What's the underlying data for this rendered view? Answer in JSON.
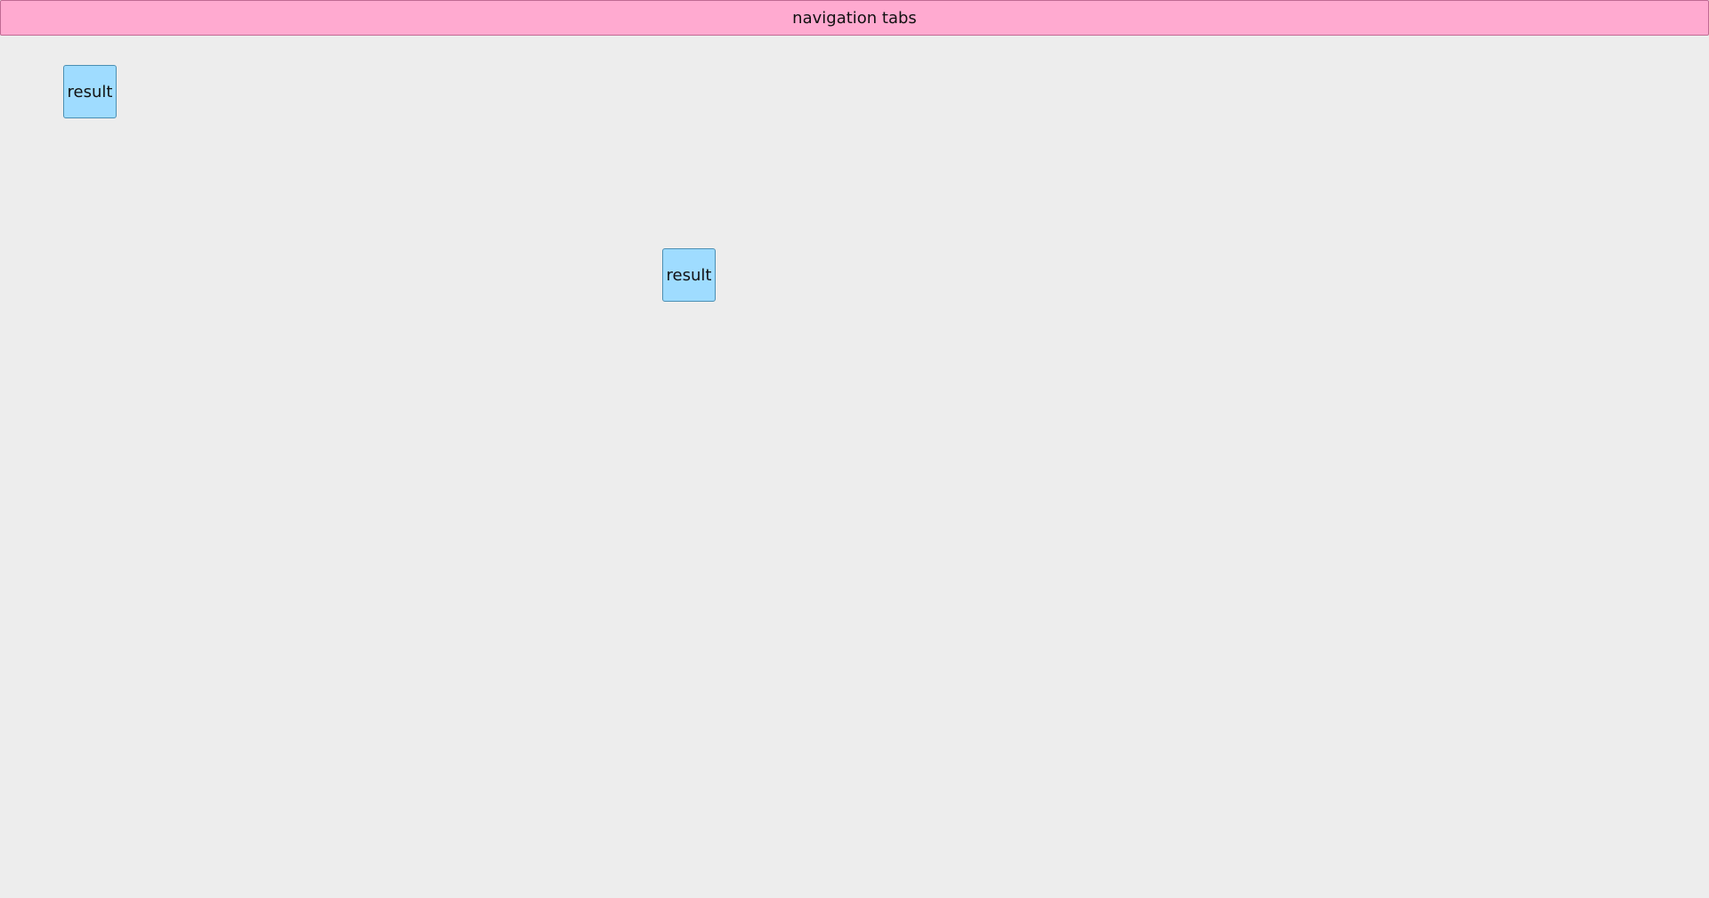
{
  "header": {
    "label": "navigation tabs"
  },
  "results": [
    {
      "label": "result"
    },
    {
      "label": "result"
    }
  ],
  "colors": {
    "background": "#ededed",
    "nav_fill": "#ffaad0",
    "nav_border": "#c06a93",
    "result_fill": "#9fdcff",
    "result_border": "#4b8fb3"
  }
}
